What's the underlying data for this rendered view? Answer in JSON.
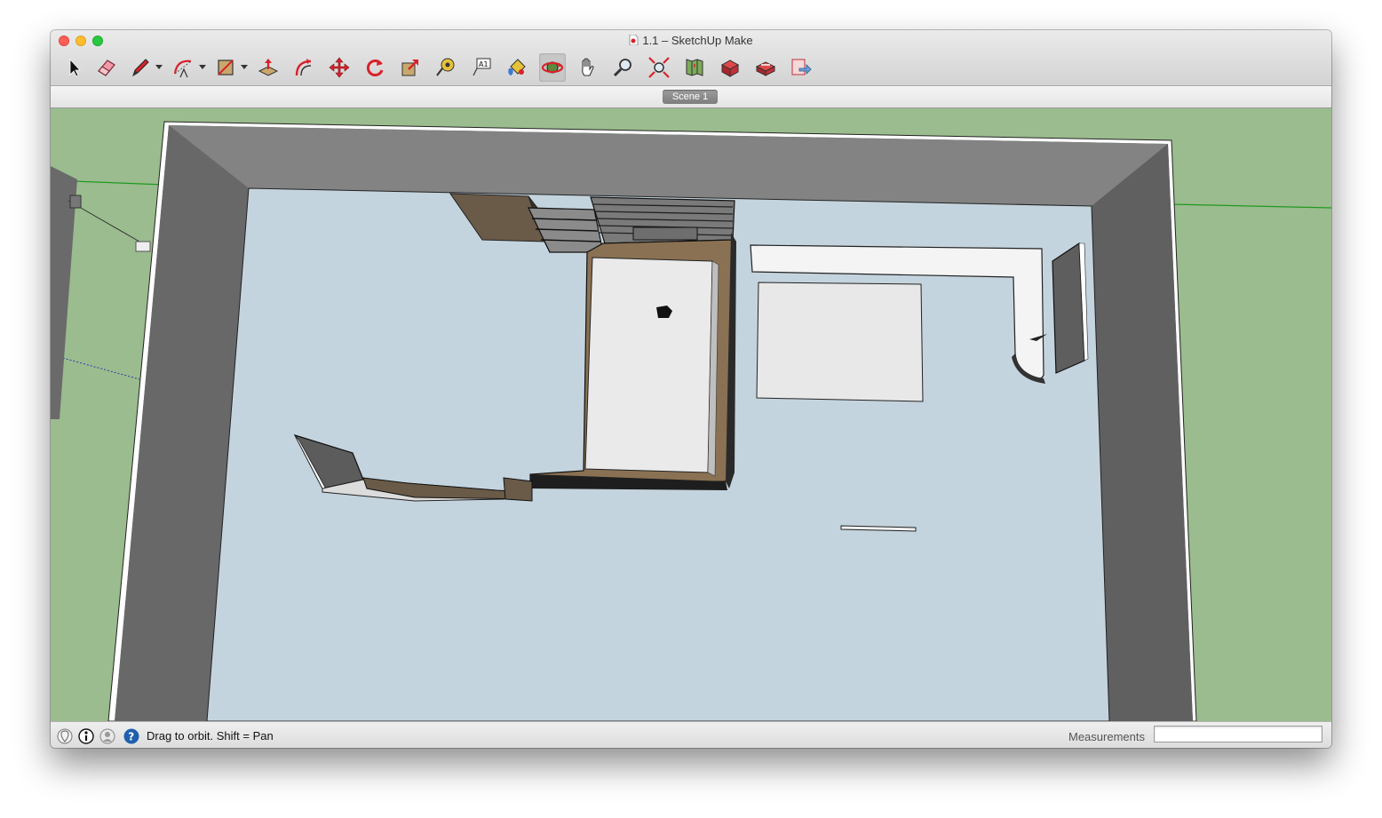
{
  "window": {
    "title": "1.1 – SketchUp Make"
  },
  "toolbar": {
    "tools": [
      {
        "name": "select-tool",
        "icon": "arrow-cursor-icon"
      },
      {
        "name": "eraser-tool",
        "icon": "eraser-icon"
      },
      {
        "name": "line-tool",
        "icon": "pencil-icon",
        "has_menu": true
      },
      {
        "name": "arc-tool",
        "icon": "arc-icon",
        "has_menu": true
      },
      {
        "name": "shapes-tool",
        "icon": "rectangle-icon",
        "has_menu": true
      },
      {
        "name": "push-pull-tool",
        "icon": "push-pull-icon"
      },
      {
        "name": "offset-tool",
        "icon": "offset-icon"
      },
      {
        "name": "move-tool",
        "icon": "move-icon"
      },
      {
        "name": "rotate-tool",
        "icon": "rotate-icon"
      },
      {
        "name": "scale-tool",
        "icon": "scale-icon"
      },
      {
        "name": "tape-measure-tool",
        "icon": "tape-measure-icon"
      },
      {
        "name": "text-tool",
        "icon": "text-icon"
      },
      {
        "name": "paint-bucket-tool",
        "icon": "paint-bucket-icon"
      },
      {
        "name": "orbit-tool",
        "icon": "orbit-icon",
        "active": true
      },
      {
        "name": "pan-tool",
        "icon": "hand-icon"
      },
      {
        "name": "zoom-tool",
        "icon": "magnifier-icon"
      },
      {
        "name": "zoom-extents-tool",
        "icon": "zoom-extents-icon"
      },
      {
        "name": "warehouse-tool",
        "icon": "map-icon"
      },
      {
        "name": "components-tool",
        "icon": "components-icon"
      },
      {
        "name": "extension-tool",
        "icon": "extension-icon"
      },
      {
        "name": "share-model-tool",
        "icon": "share-icon"
      }
    ]
  },
  "scenes": {
    "tabs": [
      {
        "label": "Scene 1"
      }
    ]
  },
  "statusbar": {
    "hint": "Drag to orbit.  Shift = Pan",
    "measurements_label": "Measurements",
    "measurements_value": ""
  },
  "colors": {
    "ground": "#9bbc8e",
    "floor": "#c4d4de",
    "wall_top": "#838383",
    "wall_side": "#666666",
    "wood": "#8a7153",
    "accent_red": "#d8222a"
  }
}
